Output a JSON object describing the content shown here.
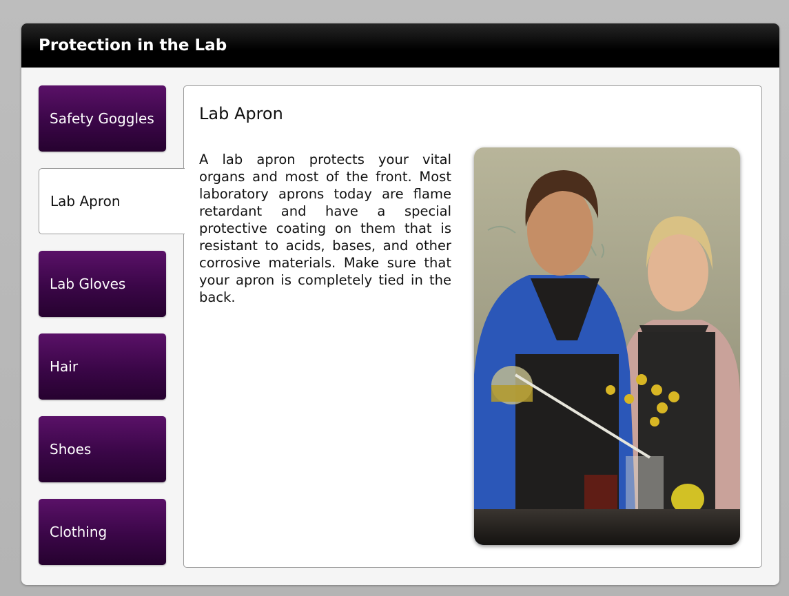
{
  "window": {
    "title": "Protection in the Lab"
  },
  "tabs": [
    {
      "label": "Safety Goggles",
      "active": false
    },
    {
      "label": "Lab Apron",
      "active": true
    },
    {
      "label": "Lab Gloves",
      "active": false
    },
    {
      "label": "Hair",
      "active": false
    },
    {
      "label": "Shoes",
      "active": false
    },
    {
      "label": "Clothing",
      "active": false
    }
  ],
  "content": {
    "heading": "Lab Apron",
    "body": "A lab apron protects your vital organs and most of the front. Most laboratory aprons today are flame retardant and have a special protective coating on them that is resistant to acids, bases, and other corrosive materials. Make sure that your apron is completely tied in the back.",
    "photo": "students-in-lab-aprons-photo"
  },
  "colors": {
    "title_bar": "#000000",
    "tab_background": "#3a0647",
    "tab_text": "#ffffff",
    "active_tab_background": "#ffffff",
    "panel_background": "#ffffff"
  }
}
